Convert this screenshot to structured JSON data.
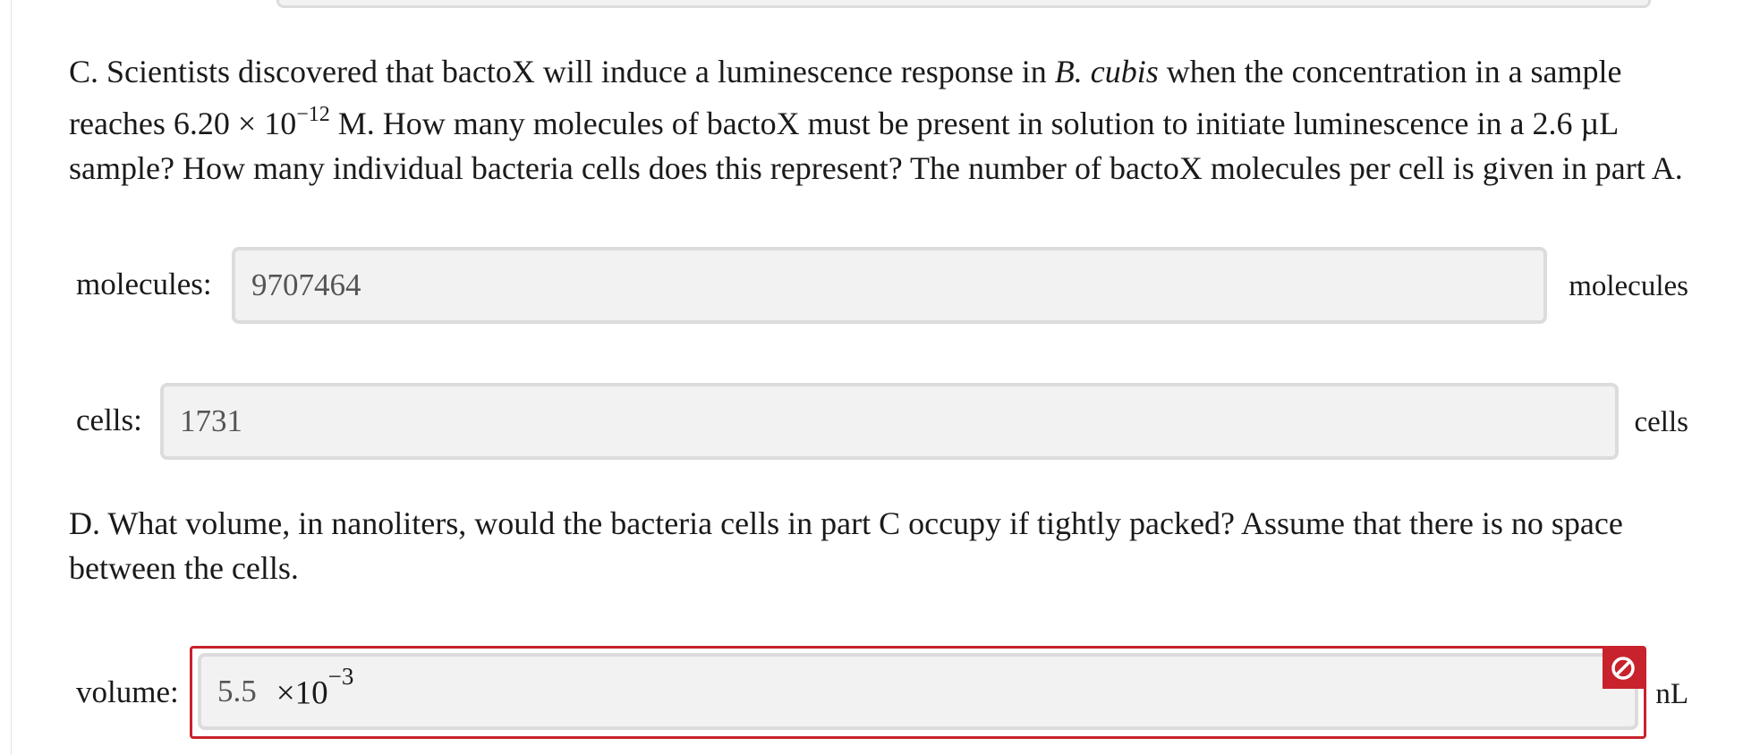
{
  "part_c": {
    "text_1": "C. Scientists discovered that bactoX will induce a luminescence response in ",
    "species": "B. cubis",
    "text_2": " when the concentration in a sample reaches 6.20 × 10",
    "exponent": "−12",
    "text_3": " M. How many molecules of bactoX must be present in solution to initiate luminescence in a 2.6 µL sample? How many individual bacteria cells does this represent? The number of bactoX molecules per cell is given in part A."
  },
  "answers": {
    "molecules": {
      "label": "molecules:",
      "value": "9707464",
      "unit": "molecules"
    },
    "cells": {
      "label": "cells:",
      "value": "1731",
      "unit": "cells"
    }
  },
  "part_d": {
    "text": "D. What volume, in nanoliters, would the bacteria cells in part C occupy if tightly packed? Assume that there is no space between the cells."
  },
  "volume": {
    "label": "volume:",
    "mantissa": "5.5",
    "times_ten": "×10",
    "exponent": "−3",
    "unit": "nL",
    "status_icon": "invalid-icon",
    "status_color": "#c8222c"
  }
}
